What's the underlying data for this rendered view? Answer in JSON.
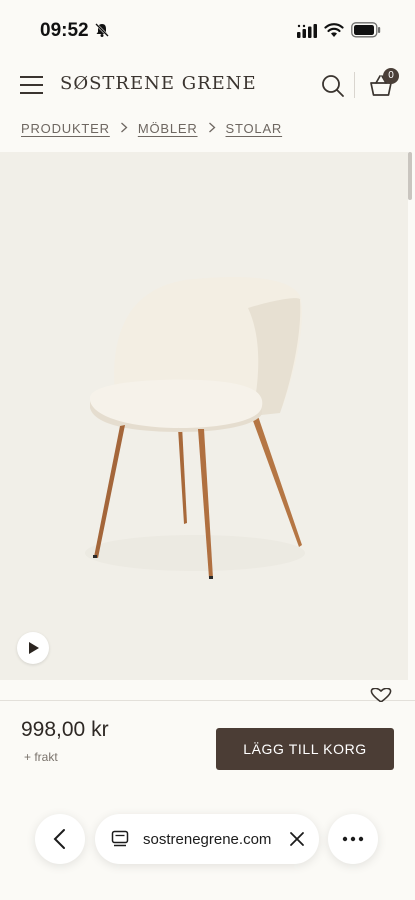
{
  "status_bar": {
    "time": "09:52"
  },
  "header": {
    "logo": "SØSTRENE GRENE",
    "basket_count": "0"
  },
  "breadcrumbs": [
    "PRODUKTER",
    "MÖBLER",
    "STOLAR"
  ],
  "product": {
    "price": "998,00 kr",
    "shipping_note": "+ frakt",
    "add_to_cart_label": "LÄGG TILL KORG"
  },
  "browser_bar": {
    "url": "sostrenegrene.com"
  },
  "colors": {
    "page_bg": "#fbfaf6",
    "image_bg": "#f1efe8",
    "button_bg": "#4b3d35",
    "text_dark": "#2e2824",
    "breadcrumb_text": "#6e6761"
  },
  "icons": [
    "bell-slash-icon",
    "cellular-signal-icon",
    "wifi-icon",
    "battery-icon",
    "hamburger-menu-icon",
    "search-icon",
    "basket-icon",
    "chevron-right-icon",
    "play-icon",
    "heart-icon",
    "chevron-left-icon",
    "tabs-icon",
    "close-icon",
    "more-icon"
  ]
}
